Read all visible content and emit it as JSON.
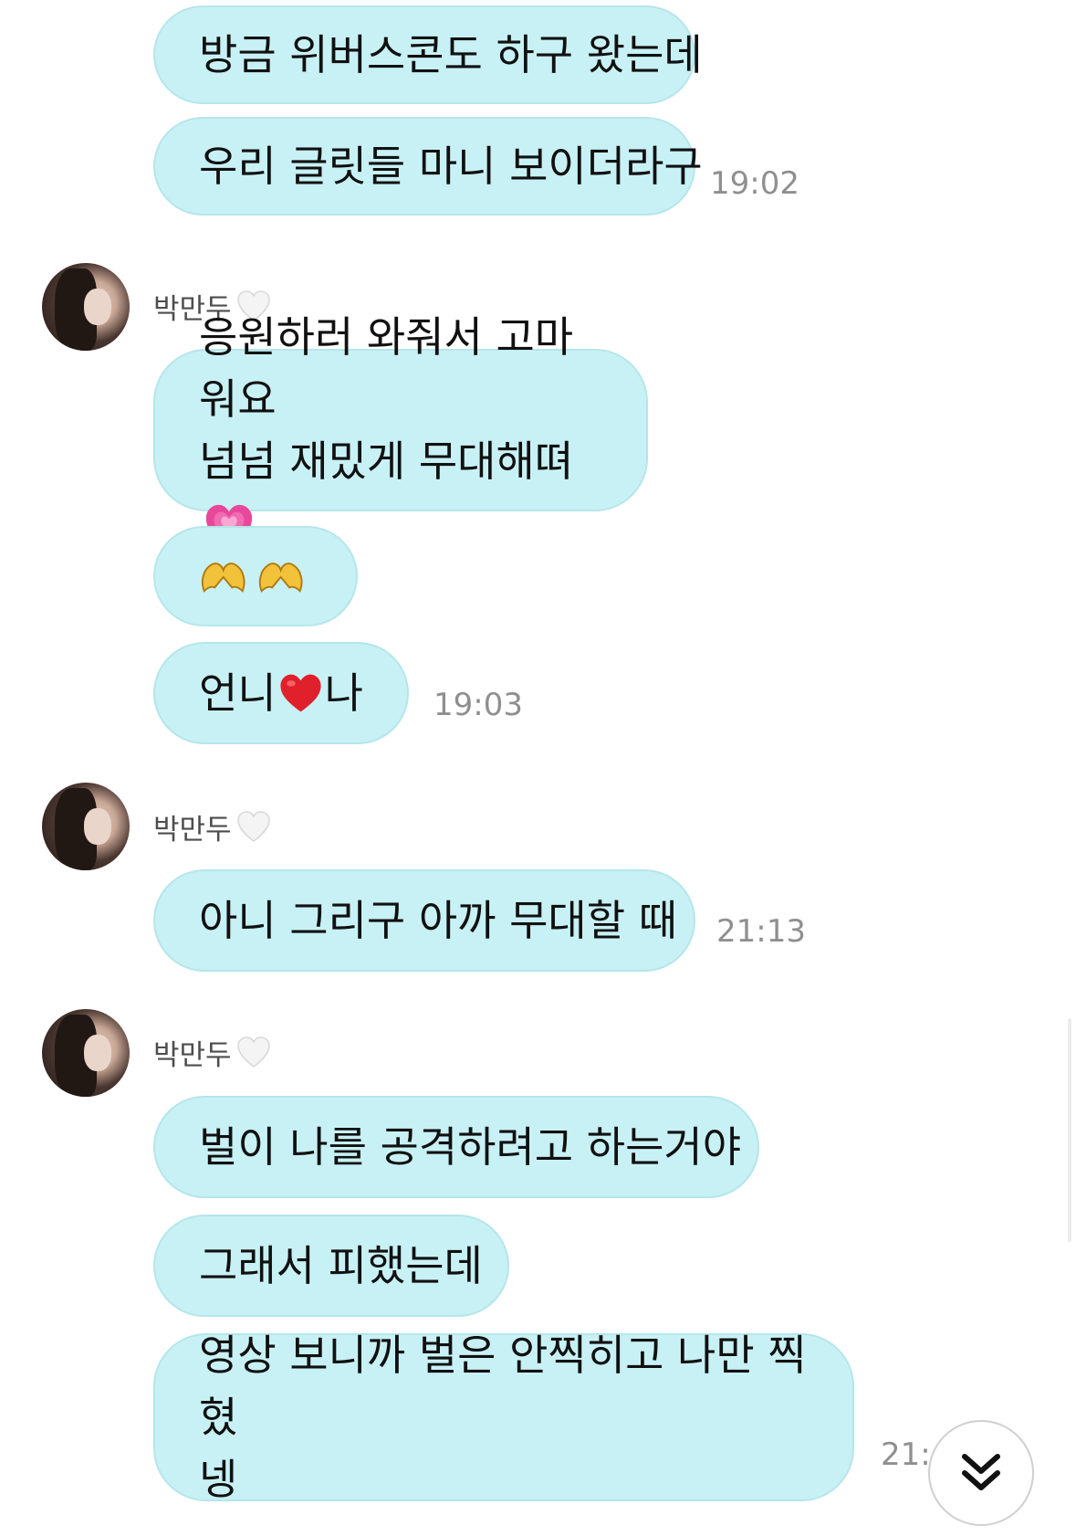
{
  "chat": {
    "group1": {
      "messages": [
        {
          "text": "방금 위버스콘도 하구 왔는데"
        },
        {
          "text": "우리 글릿들 마니 보이더라구"
        }
      ],
      "time": "19:02"
    },
    "group2": {
      "sender": "박만두",
      "sender_badge": "white-heart-icon",
      "messages": [
        {
          "line1": "응원하러 와줘서 고마워요",
          "line2": "넘넘 재밌게 무대해뗘",
          "emoji": "growing-heart-icon"
        },
        {
          "emoji": "heart-hands-icon"
        },
        {
          "text_before": "언니",
          "emoji": "red-heart-icon",
          "text_after": "나"
        }
      ],
      "time": "19:03"
    },
    "group3": {
      "sender": "박만두",
      "sender_badge": "white-heart-icon",
      "messages": [
        {
          "text": "아니 그리구 아까 무대할 때"
        }
      ],
      "time": "21:13"
    },
    "group4": {
      "sender": "박만두",
      "sender_badge": "white-heart-icon",
      "messages": [
        {
          "text": "벌이 나를 공격하려고 하는거야"
        },
        {
          "text": "그래서 피했는데"
        },
        {
          "line1": "영상 보니까 벌은 안찍히고 나만 찍혔",
          "line2": "넹"
        }
      ],
      "time": "21:"
    }
  },
  "scroll_button": {
    "icon": "double-chevron-down-icon"
  },
  "colors": {
    "bubble": "#c8f1f5",
    "bubble_border": "#b5e6ea",
    "time": "#8f8f8f"
  }
}
